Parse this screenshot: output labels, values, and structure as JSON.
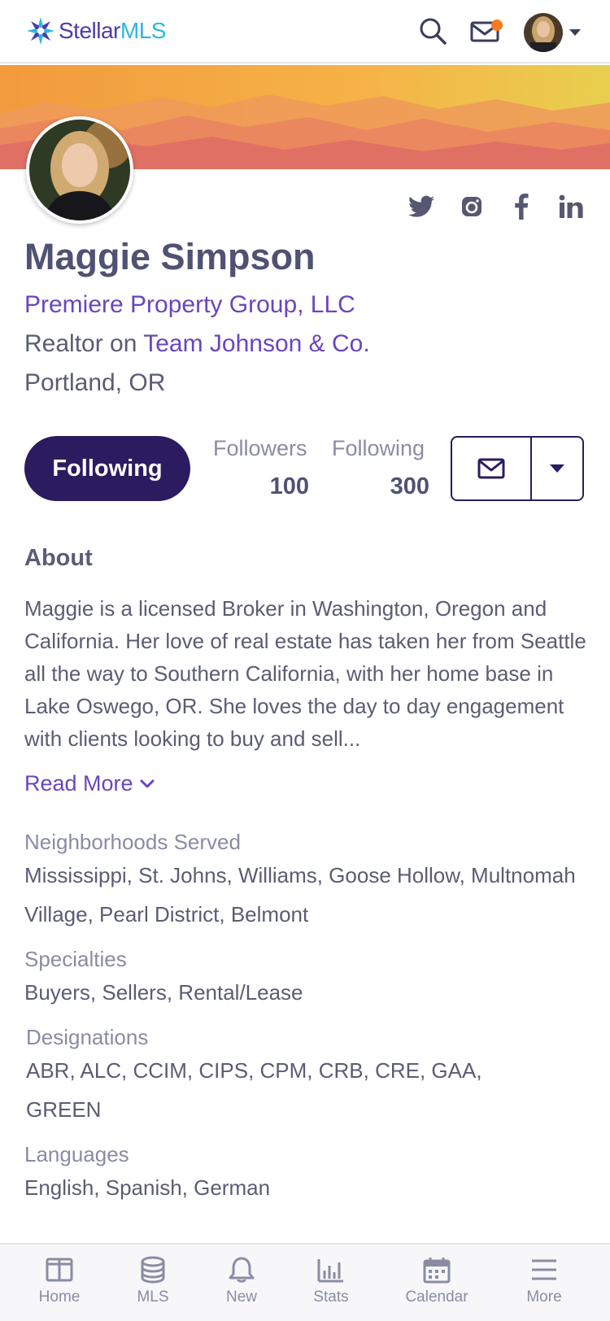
{
  "header": {
    "logo_part1": "Stellar",
    "logo_part2": "MLS"
  },
  "profile": {
    "name": "Maggie Simpson",
    "company": "Premiere Property Group, LLC",
    "role_prefix": "Realtor on ",
    "team": "Team Johnson & Co.",
    "location": "Portland, OR"
  },
  "social": [
    "twitter-icon",
    "instagram-icon",
    "facebook-icon",
    "linkedin-icon"
  ],
  "actions": {
    "follow_label": "Following",
    "followers_label": "Followers",
    "followers_count": "100",
    "following_label": "Following",
    "following_count": "300"
  },
  "about": {
    "title": "About",
    "body": "Maggie is a licensed Broker in Washington, Oregon and California. Her love of real estate has taken her from Seattle all the way to Southern California, with her home base in Lake Oswego, OR. She loves the day to day engagement with clients looking to buy and sell...",
    "read_more": "Read More"
  },
  "details": {
    "neighborhoods_label": "Neighborhoods Served",
    "neighborhoods_value": "Mississippi, St. Johns, Williams, Goose Hollow, Multnomah Village, Pearl District, Belmont",
    "specialties_label": "Specialties",
    "specialties_value": "Buyers, Sellers, Rental/Lease",
    "designations_label": "Designations",
    "designations_value": "ABR, ALC, CCIM, CIPS, CPM, CRB, CRE, GAA, GREEN",
    "languages_label": "Languages",
    "languages_value": "English, Spanish, German"
  },
  "nav": {
    "items": [
      {
        "label": "Home",
        "icon": "home-icon"
      },
      {
        "label": "MLS",
        "icon": "database-icon"
      },
      {
        "label": "New",
        "icon": "bell-icon"
      },
      {
        "label": "Stats",
        "icon": "bar-chart-icon"
      },
      {
        "label": "Calendar",
        "icon": "calendar-icon"
      },
      {
        "label": "More",
        "icon": "menu-icon"
      }
    ]
  },
  "colors": {
    "accent": "#6a45bf",
    "primary_dark": "#2c1b5f",
    "notification": "#f47b20",
    "text": "#5a5d73"
  }
}
